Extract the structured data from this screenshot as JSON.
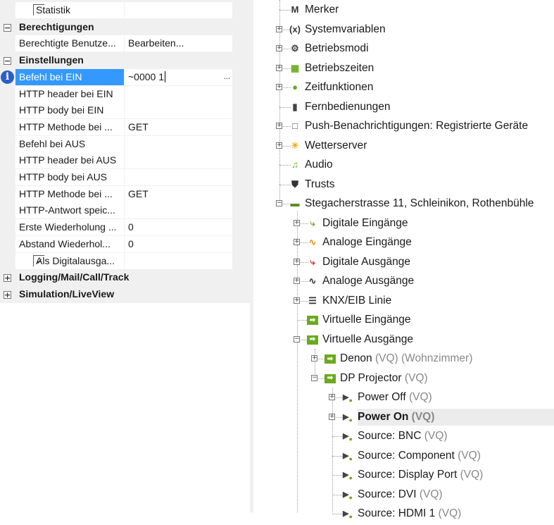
{
  "properties": {
    "rows": [
      {
        "type": "check",
        "label": "Statistik",
        "checked": false,
        "value": ""
      },
      {
        "type": "cat",
        "label": "Berechtigungen",
        "expanded": true
      },
      {
        "type": "prop",
        "label": "Berechtigte Benutze...",
        "value": "Bearbeiten..."
      },
      {
        "type": "cat",
        "label": "Einstellungen",
        "expanded": true
      },
      {
        "type": "prop",
        "label": "Befehl bei EIN",
        "value": "~0000 1",
        "selected": true,
        "button": "..."
      },
      {
        "type": "prop",
        "label": "HTTP header bei EIN",
        "value": ""
      },
      {
        "type": "prop",
        "label": "HTTP body bei EIN",
        "value": ""
      },
      {
        "type": "prop",
        "label": "HTTP Methode bei ...",
        "value": "GET"
      },
      {
        "type": "prop",
        "label": "Befehl bei AUS",
        "value": ""
      },
      {
        "type": "prop",
        "label": "HTTP header bei AUS",
        "value": ""
      },
      {
        "type": "prop",
        "label": "HTTP body bei AUS",
        "value": ""
      },
      {
        "type": "prop",
        "label": "HTTP Methode bei ...",
        "value": "GET"
      },
      {
        "type": "prop",
        "label": "HTTP-Antwort speic...",
        "value": ""
      },
      {
        "type": "prop",
        "label": "Erste Wiederholung ...",
        "value": "0"
      },
      {
        "type": "prop",
        "label": "Abstand Wiederhol...",
        "value": "0"
      },
      {
        "type": "check",
        "label": "Als Digitalausga...",
        "checked": true,
        "value": ""
      },
      {
        "type": "cat",
        "label": "Logging/Mail/Call/Track",
        "expanded": false
      },
      {
        "type": "cat",
        "label": "Simulation/LiveView",
        "expanded": false
      }
    ]
  },
  "tree": {
    "items": [
      {
        "level": 0,
        "exp": "",
        "icon": "M",
        "icon_name": "merker-icon",
        "color": "#333333",
        "label": "Merker",
        "suffix": ""
      },
      {
        "level": 0,
        "exp": "+",
        "icon": "(x)",
        "icon_name": "variable-icon",
        "color": "#333333",
        "label": "Systemvariablen",
        "suffix": ""
      },
      {
        "level": 0,
        "exp": "+",
        "icon": "⚙",
        "icon_name": "gear-clock-icon",
        "color": "#444444",
        "label": "Betriebsmodi",
        "suffix": ""
      },
      {
        "level": 0,
        "exp": "+",
        "icon": "▦",
        "icon_name": "calendar-icon",
        "color": "#6aaa1e",
        "label": "Betriebszeiten",
        "suffix": ""
      },
      {
        "level": 0,
        "exp": "+",
        "icon": "●",
        "icon_name": "clock-icon",
        "color": "#6aaa1e",
        "label": "Zeitfunktionen",
        "suffix": ""
      },
      {
        "level": 0,
        "exp": "",
        "icon": "▮",
        "icon_name": "remote-icon",
        "color": "#444444",
        "label": "Fernbedienungen",
        "suffix": ""
      },
      {
        "level": 0,
        "exp": "+",
        "icon": "□",
        "icon_name": "push-notification-icon",
        "color": "#444444",
        "label": "Push-Benachrichtigungen: Registrierte Geräte",
        "suffix": ""
      },
      {
        "level": 0,
        "exp": "+",
        "icon": "☀",
        "icon_name": "weather-icon",
        "color": "#f0b020",
        "label": "Wetterserver",
        "suffix": ""
      },
      {
        "level": 0,
        "exp": "",
        "icon": "♫",
        "icon_name": "music-icon",
        "color": "#6aaa1e",
        "label": "Audio",
        "suffix": ""
      },
      {
        "level": 0,
        "exp": "",
        "icon": "⛊",
        "icon_name": "trust-icon",
        "color": "#333333",
        "label": "Trusts",
        "suffix": ""
      },
      {
        "level": 0,
        "exp": "-",
        "icon": "▬",
        "icon_name": "miniserver-icon",
        "color": "#5a8a1e",
        "label": "Stegacherstrasse 11, Schleinikon, Rothenbühle",
        "suffix": ""
      },
      {
        "level": 1,
        "exp": "+",
        "icon": "⤷",
        "icon_name": "digital-input-icon",
        "color": "#6aaa1e",
        "label": "Digitale Eingänge",
        "suffix": ""
      },
      {
        "level": 1,
        "exp": "+",
        "icon": "∿",
        "icon_name": "analog-input-icon",
        "color": "#e89020",
        "label": "Analoge Eingänge",
        "suffix": ""
      },
      {
        "level": 1,
        "exp": "+",
        "icon": "⤷",
        "icon_name": "digital-output-icon",
        "color": "#e02020",
        "label": "Digitale Ausgänge",
        "suffix": ""
      },
      {
        "level": 1,
        "exp": "+",
        "icon": "∿",
        "icon_name": "analog-output-icon",
        "color": "#333333",
        "label": "Analoge Ausgänge",
        "suffix": ""
      },
      {
        "level": 1,
        "exp": "+",
        "icon": "☰",
        "icon_name": "knx-icon",
        "color": "#333333",
        "label": "KNX/EIB Linie",
        "suffix": ""
      },
      {
        "level": 1,
        "exp": "",
        "icon": "➡",
        "icon_name": "virtual-input-icon",
        "color": "#6aaa1e",
        "label": "Virtuelle Eingänge",
        "suffix": ""
      },
      {
        "level": 1,
        "exp": "-",
        "icon": "➡",
        "icon_name": "virtual-output-icon",
        "color": "#6aaa1e",
        "label": "Virtuelle Ausgänge",
        "suffix": ""
      },
      {
        "level": 2,
        "exp": "+",
        "icon": "➡",
        "icon_name": "virtual-output-icon",
        "color": "#6aaa1e",
        "label": "Denon",
        "suffix": "(VQ) (Wohnzimmer)"
      },
      {
        "level": 2,
        "exp": "-",
        "icon": "➡",
        "icon_name": "virtual-output-icon",
        "color": "#6aaa1e",
        "label": "DP Projector",
        "suffix": "(VQ)"
      },
      {
        "level": 3,
        "exp": "+",
        "icon": "▶",
        "icon_name": "command-icon",
        "color": "#444444",
        "label": "Power Off",
        "suffix": "(VQ)"
      },
      {
        "level": 3,
        "exp": "+",
        "icon": "▶",
        "icon_name": "command-icon",
        "color": "#444444",
        "label": "Power On",
        "suffix": "(VQ)",
        "selected": true
      },
      {
        "level": 3,
        "exp": "",
        "icon": "▶",
        "icon_name": "command-icon",
        "color": "#444444",
        "label": "Source: BNC",
        "suffix": "(VQ)"
      },
      {
        "level": 3,
        "exp": "",
        "icon": "▶",
        "icon_name": "command-icon",
        "color": "#444444",
        "label": "Source: Component",
        "suffix": "(VQ)"
      },
      {
        "level": 3,
        "exp": "",
        "icon": "▶",
        "icon_name": "command-icon",
        "color": "#444444",
        "label": "Source: Display Port",
        "suffix": "(VQ)"
      },
      {
        "level": 3,
        "exp": "",
        "icon": "▶",
        "icon_name": "command-icon",
        "color": "#444444",
        "label": "Source: DVI",
        "suffix": "(VQ)"
      },
      {
        "level": 3,
        "exp": "",
        "icon": "▶",
        "icon_name": "command-icon",
        "color": "#444444",
        "label": "Source: HDMI 1",
        "suffix": "(VQ)"
      }
    ]
  }
}
